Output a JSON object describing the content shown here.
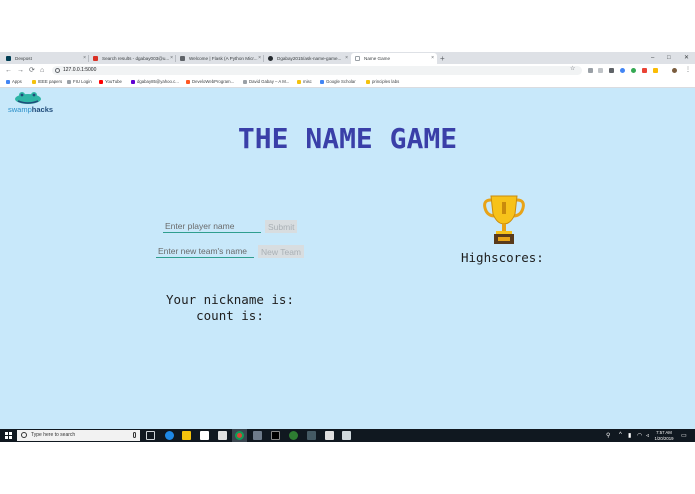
{
  "browser": {
    "tabs": [
      {
        "label": "Devpost",
        "favicon_color": "#003e54"
      },
      {
        "label": "Search results - dgabay003@u...",
        "favicon_color": "#d93025"
      },
      {
        "label": "Welcome | Flask (A Python Micr...",
        "favicon_color": "#5f6368"
      },
      {
        "label": "Dgabay2015/ask-name-game...",
        "favicon_color": "#24292e"
      },
      {
        "label": "Name Game",
        "favicon_color": "#9aa0a6"
      }
    ],
    "new_tab_symbol": "+",
    "close_symbol": "×",
    "window_controls": {
      "minimize": "–",
      "maximize": "□",
      "close": "✕"
    },
    "nav": {
      "back": "←",
      "forward": "→",
      "reload": "⟳",
      "home": "⌂"
    },
    "url": "127.0.0.1:5000",
    "star": "☆",
    "bookmarks": [
      {
        "label": "Apps",
        "color": "#4285f4"
      },
      {
        "label": "IEEE papers",
        "color": "#f4c20d"
      },
      {
        "label": "FIU Login",
        "color": "#9aa0a6"
      },
      {
        "label": "YouTube",
        "color": "#ff0000"
      },
      {
        "label": "dgabay85@yahoo.c...",
        "color": "#6001d2"
      },
      {
        "label": "DeveloWebProgram...",
        "color": "#ff5722"
      },
      {
        "label": "David Gabay – A M...",
        "color": "#9aa0a6"
      },
      {
        "label": "misc",
        "color": "#f4c20d"
      },
      {
        "label": "Google Scholar",
        "color": "#4285f4"
      },
      {
        "label": "principles labs",
        "color": "#f4c20d"
      }
    ]
  },
  "page": {
    "logo_swamp": "swamp",
    "logo_hacks": "hacks",
    "title": "THE NAME GAME",
    "player_input_placeholder": "Enter player name",
    "submit_label": "Submit",
    "team_input_placeholder": "Enter new team's name",
    "new_team_label": "New Team",
    "highscores_label": "Highscores:",
    "nickname_label": "Your nickname is:",
    "count_label": "count is:"
  },
  "taskbar": {
    "search_placeholder": "Type here to search",
    "time": "7:57 AM",
    "date": "1/20/2019",
    "notification_symbol": "▭"
  },
  "colors": {
    "page_bg": "#c8e8fa",
    "title": "#3a3fa8",
    "input_underline": "#2f9e8f",
    "button_bg": "#d8dde0",
    "taskbar_bg": "#101820"
  }
}
